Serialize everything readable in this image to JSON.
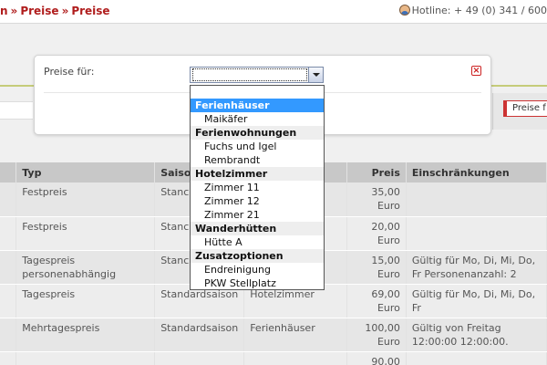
{
  "breadcrumb": [
    "n",
    "Preise",
    "Preise"
  ],
  "breadcrumb_sep": "»",
  "hotline": "Hotline: + 49 (0) 341 / 600",
  "side_button": "Preise f",
  "dialog": {
    "label": "Preise für:",
    "close_glyph": "×",
    "select_value": ""
  },
  "dropdown": {
    "groups": [
      {
        "label": "Ferienhäuser",
        "selected": true,
        "options": [
          "Maikäfer"
        ]
      },
      {
        "label": "Ferienwohnungen",
        "selected": false,
        "options": [
          "Fuchs und Igel",
          "Rembrandt"
        ]
      },
      {
        "label": "Hotelzimmer",
        "selected": false,
        "options": [
          "Zimmer 11",
          "Zimmer 12",
          "Zimmer 21"
        ]
      },
      {
        "label": "Wanderhütten",
        "selected": false,
        "options": [
          "Hütte A"
        ]
      },
      {
        "label": "Zusatzoptionen",
        "selected": false,
        "options": [
          "Endreinigung",
          "PKW Stellplatz"
        ]
      }
    ]
  },
  "table": {
    "headers": [
      "",
      "Typ",
      "Saiso",
      "",
      "Preis",
      "Einschränkungen"
    ],
    "rows": [
      [
        "",
        "Festpreis",
        "Stanc",
        "",
        "35,00 Euro",
        ""
      ],
      [
        "",
        "Festpreis",
        "Stanc",
        "",
        "20,00 Euro",
        ""
      ],
      [
        "",
        "Tagespreis personenabhängig",
        "Stanc",
        "",
        "15,00 Euro",
        "Gültig für Mo, Di, Mi, Do, Fr Personenanzahl: 2"
      ],
      [
        "",
        "Tagespreis",
        "Standardsaison",
        "Hotelzimmer",
        "69,00 Euro",
        "Gültig für Mo, Di, Mi, Do, Fr"
      ],
      [
        "",
        "Mehrtagespreis",
        "Standardsaison",
        "Ferienhäuser",
        "100,00 Euro",
        "Gültig von Freitag 12:00:00 12:00:00."
      ],
      [
        "",
        "",
        "",
        "",
        "90,00",
        ""
      ]
    ]
  },
  "colors": {
    "accent": "#b01d1d",
    "selected": "#3399ff",
    "header": "#c8c8c8"
  }
}
